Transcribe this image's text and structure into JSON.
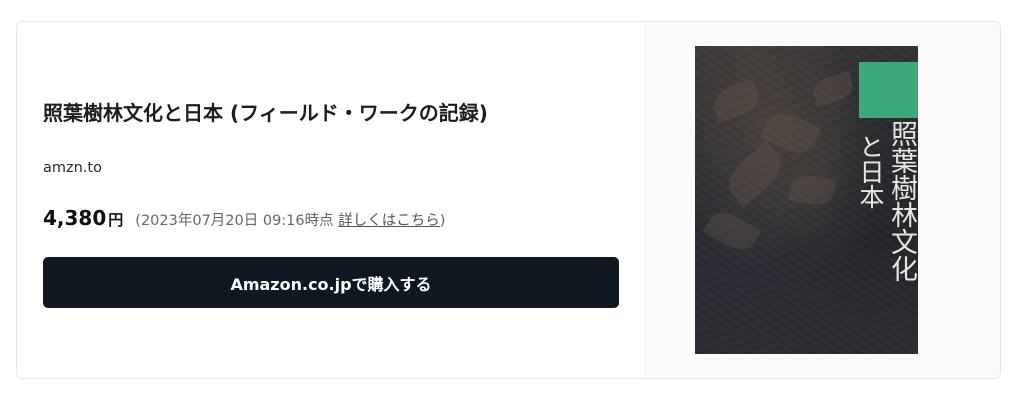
{
  "product": {
    "title": "照葉樹林文化と日本 (フィールド・ワークの記録)",
    "domain": "amzn.to",
    "price": "4,380",
    "currency": "円",
    "price_note_prefix": "(2023年07月20日 09:16時点 ",
    "detail_link": "詳しくはこちら",
    "price_note_suffix": ")",
    "buy_button": "Amazon.co.jpで購入する"
  },
  "cover": {
    "title_line1": "照葉樹林文化",
    "title_line2": "と日本",
    "accent_color": "#3ea978",
    "background_color": "#2a2b30"
  },
  "colors": {
    "button_bg": "#0f171f",
    "button_text": "#ffffff"
  }
}
